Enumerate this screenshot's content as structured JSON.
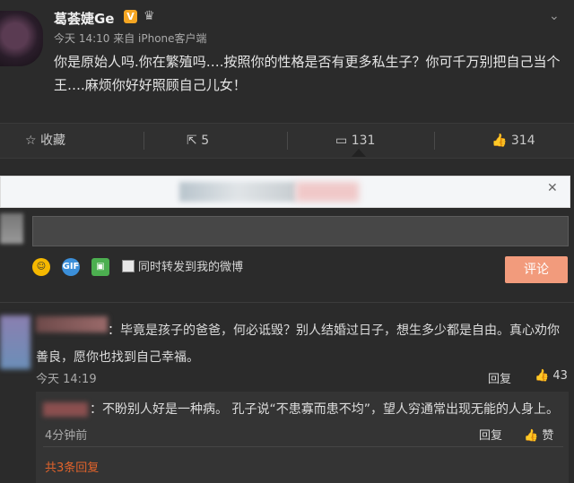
{
  "post": {
    "author": "葛荟婕Ge",
    "verified_badge": "V",
    "meta": "今天 14:10 来自 iPhone客户端",
    "text": "你是原始人吗.你在繁殖吗….按照你的性格是否有更多私生子？你可千万别把自己当个王….麻烦你好好照顾自己儿女！"
  },
  "actions": {
    "favorite_label": "收藏",
    "forward_count": "5",
    "comment_count": "131",
    "like_count": "314"
  },
  "composer": {
    "forward_label": "同时转发到我的微博",
    "submit_label": "评论"
  },
  "comment": {
    "text": "：毕竟是孩子的爸爸，何必诋毁？别人结婚过日子，想生多少都是自由。真心劝你善良，愿你也找到自己幸福。",
    "time": "今天 14:19",
    "reply_label": "回复",
    "like_count": "43"
  },
  "nested_reply": {
    "text": "：不盼别人好是一种病。 孔子说“不患寡而患不均”，望人穷通常出现无能的人身上。",
    "time": "4分钟前",
    "reply_label": "回复",
    "like_label": "赞",
    "more_label": "共3条回复"
  },
  "colors": {
    "background": "#2b2b2b",
    "submit_button": "#f29b7c",
    "verified": "#f5a623",
    "more_link": "#e2632b"
  }
}
